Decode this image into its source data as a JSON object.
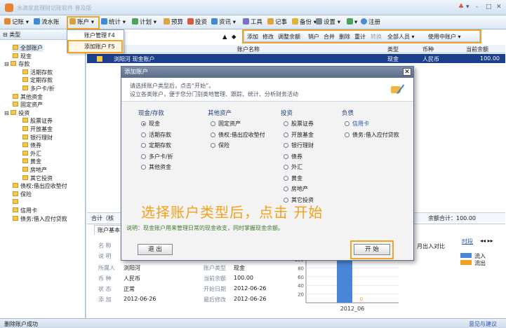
{
  "window": {
    "title": "水滴家庭理财记账软件 普及版",
    "controls": [
      "♣",
      "▾",
      "-",
      "□",
      "✕"
    ]
  },
  "toolbar": {
    "items": [
      {
        "label": "记账",
        "color": "#e2872e"
      },
      {
        "label": "流水账",
        "color": "#3c8ad8"
      },
      {
        "label": "账户",
        "color": "#d8a23b"
      },
      {
        "label": "统计",
        "color": "#3c8ad8"
      },
      {
        "label": "计划",
        "color": "#4aa55a"
      },
      {
        "label": "预算",
        "color": "#e0a33b"
      },
      {
        "label": "投资",
        "color": "#d85a3a"
      },
      {
        "label": "资讯",
        "color": "#3c8ad8"
      },
      {
        "label": "工具",
        "color": "#7b6fd0"
      },
      {
        "label": "记事",
        "color": "#e0a33b"
      },
      {
        "label": "备份",
        "color": "#e0b23b"
      },
      {
        "label": "设置",
        "color": "#7a8a9a"
      },
      {
        "label": "注册",
        "color": "#4a8ad8"
      }
    ]
  },
  "account_menu": {
    "items": [
      {
        "label": "账户管理",
        "key": "F4"
      },
      {
        "label": "添加账户",
        "key": "F5"
      }
    ]
  },
  "left_panel": {
    "header": "类型",
    "tree": [
      {
        "label": "全部账户",
        "level": 1,
        "selected": true
      },
      {
        "label": "现金",
        "level": 1
      },
      {
        "label": "存款",
        "level": 0
      },
      {
        "label": "活期存款",
        "level": 2
      },
      {
        "label": "定期存款",
        "level": 2
      },
      {
        "label": "多户卡/折",
        "level": 2
      },
      {
        "label": "其他资金",
        "level": 1
      },
      {
        "label": "固定资产",
        "level": 1
      },
      {
        "label": "投资",
        "level": 0
      },
      {
        "label": "股票证券",
        "level": 2
      },
      {
        "label": "开放基金",
        "level": 2
      },
      {
        "label": "银行理财",
        "level": 2
      },
      {
        "label": "债券",
        "level": 2
      },
      {
        "label": "外汇",
        "level": 2
      },
      {
        "label": "黄金",
        "level": 2
      },
      {
        "label": "房地产",
        "level": 2
      },
      {
        "label": "其它投资",
        "level": 2
      },
      {
        "label": "债权:借出应收垫付",
        "level": 1
      },
      {
        "label": "保险",
        "level": 1
      },
      {
        "label": "",
        "level": 1
      },
      {
        "label": "信用卡",
        "level": 1
      },
      {
        "label": "债务:借入应付贷款",
        "level": 1
      }
    ]
  },
  "filterbar": {
    "items": [
      "添加",
      "修改",
      "调整余额",
      "销户",
      "合并",
      "删除",
      "重计",
      "转换",
      "全部人员 ▾",
      "使用中账户 ▾"
    ]
  },
  "grid": {
    "headers": [
      "账户名称",
      "类型",
      "币种",
      "当前余额"
    ],
    "row": {
      "name": "浏阳河 现金账户",
      "type": "现金",
      "currency": "人民币",
      "balance": "100.00"
    }
  },
  "summary": {
    "left": "合计（核",
    "right": "余额合计：100.00"
  },
  "bottom": {
    "tab": "账户基本",
    "labels": {
      "name": "名 称",
      "desc": "说 明",
      "owner": "所属人",
      "currency": "币 种",
      "state": "状 态",
      "added": "添 加"
    },
    "values": {
      "owner": "浏阳河",
      "currency": "人民币",
      "state": "正常",
      "added": "2012-06-26",
      "type_label": "账户类型",
      "type": "现金",
      "balance_label": "当前余额",
      "balance": "100.00",
      "start_label": "开始日期",
      "start": "2012-06-26",
      "modified_label": "最后修改",
      "modified": "2012-06-26"
    },
    "chart_caption": "月出入对比",
    "chart_link": "时段",
    "nav": "◂◂ ▸▸"
  },
  "chart_data": {
    "type": "bar",
    "categories": [
      "2012_06"
    ],
    "series": [
      {
        "name": "流入",
        "values": [
          100
        ]
      },
      {
        "name": "流出",
        "values": [
          0
        ]
      }
    ],
    "ylim": [
      0,
      100
    ],
    "yticks": [
      "100",
      "80",
      "60",
      "40",
      "20"
    ],
    "bar_labels": [
      "",
      "0"
    ],
    "colors": [
      "#4a86d8",
      "#f0a020"
    ]
  },
  "dialog": {
    "title": "添加账户",
    "close": "✕",
    "banner": [
      "请选择账户类型后，点击“开始”。",
      "设立各类账户，便于您分门别类地管理、跟踪、统计、分析财务活动"
    ],
    "columns": [
      {
        "header": "现金/存款",
        "options": [
          {
            "label": "现金",
            "checked": true
          },
          {
            "label": "活期存款"
          },
          {
            "label": "定期存款"
          },
          {
            "label": "多户卡/折"
          },
          {
            "label": "其他资金"
          }
        ]
      },
      {
        "header": "其他资产",
        "options": [
          {
            "label": "固定资产"
          },
          {
            "label": "债权:借出应收垫付"
          },
          {
            "label": "保险"
          }
        ]
      },
      {
        "header": "投资",
        "options": [
          {
            "label": "股票证券"
          },
          {
            "label": "开放基金"
          },
          {
            "label": "银行理财"
          },
          {
            "label": "债券"
          },
          {
            "label": "外汇"
          },
          {
            "label": "黄金"
          },
          {
            "label": "房地产"
          },
          {
            "label": "其它投资"
          }
        ]
      },
      {
        "header": "负债",
        "options": [
          {
            "label": "信用卡",
            "blue": true
          },
          {
            "label": "债务:借入应付贷款"
          }
        ]
      }
    ],
    "overlay_text": "选择账户类型后，点击 开始",
    "note": "说明：现金账户用来管理日常的现金收支，同时掌握现金余额。",
    "exit_label": "退 出",
    "start_label": "开 始"
  },
  "status": {
    "left": "删除账户成功",
    "right": "意见与建议"
  }
}
